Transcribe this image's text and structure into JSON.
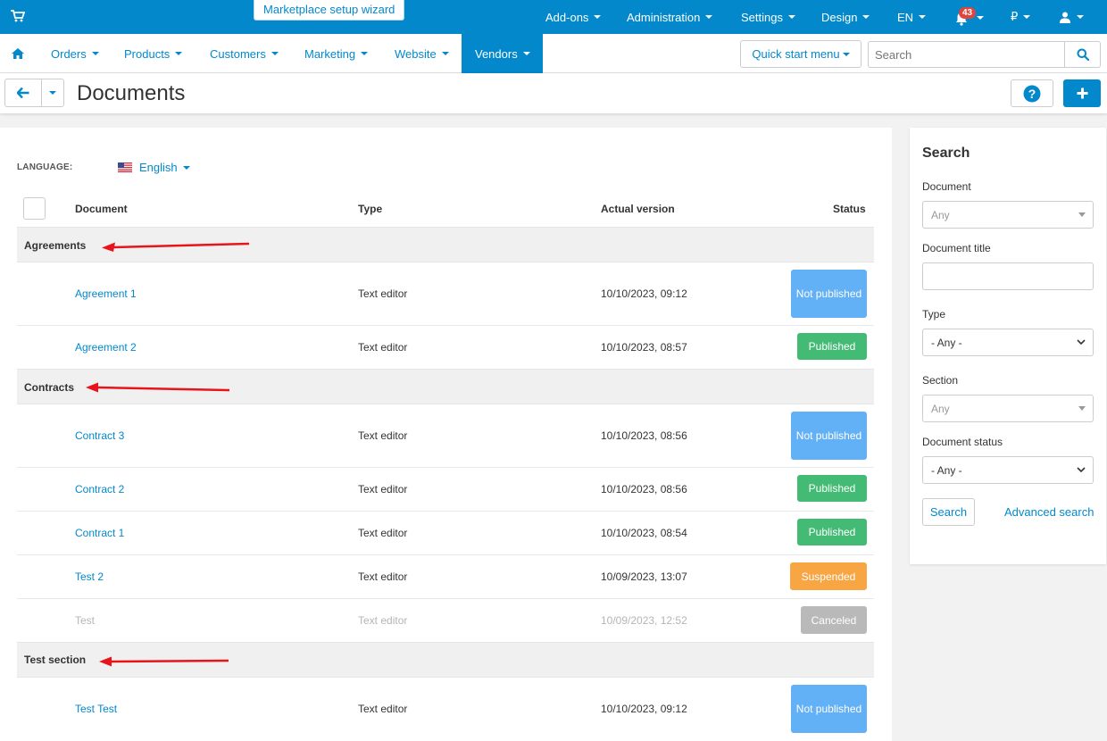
{
  "topbar": {
    "wizard_label": "Marketplace setup wizard",
    "menu": [
      {
        "label": "Add-ons"
      },
      {
        "label": "Administration"
      },
      {
        "label": "Settings"
      },
      {
        "label": "Design"
      },
      {
        "label": "EN"
      }
    ],
    "notifications_count": "43",
    "currency": "₽"
  },
  "nav": {
    "items": [
      {
        "label": "Orders"
      },
      {
        "label": "Products"
      },
      {
        "label": "Customers"
      },
      {
        "label": "Marketing"
      },
      {
        "label": "Website"
      },
      {
        "label": "Vendors"
      }
    ],
    "quick_start": "Quick start menu",
    "search_placeholder": "Search"
  },
  "page": {
    "title": "Documents"
  },
  "main": {
    "language_label": "LANGUAGE:",
    "language_value": "English",
    "columns": {
      "document": "Document",
      "type": "Type",
      "version": "Actual version",
      "status": "Status"
    },
    "groups": [
      {
        "name": "Agreements",
        "rows": [
          {
            "doc": "Agreement 1",
            "type": "Text editor",
            "version": "10/10/2023, 09:12",
            "status": "Not published"
          },
          {
            "doc": "Agreement 2",
            "type": "Text editor",
            "version": "10/10/2023, 08:57",
            "status": "Published"
          }
        ]
      },
      {
        "name": "Contracts",
        "rows": [
          {
            "doc": "Contract 3",
            "type": "Text editor",
            "version": "10/10/2023, 08:56",
            "status": "Not published"
          },
          {
            "doc": "Contract 2",
            "type": "Text editor",
            "version": "10/10/2023, 08:56",
            "status": "Published"
          },
          {
            "doc": "Contract 1",
            "type": "Text editor",
            "version": "10/10/2023, 08:54",
            "status": "Published"
          },
          {
            "doc": "Test 2",
            "type": "Text editor",
            "version": "10/09/2023, 13:07",
            "status": "Suspended"
          },
          {
            "doc": "Test",
            "type": "Text editor",
            "version": "10/09/2023, 12:52",
            "status": "Canceled"
          }
        ]
      },
      {
        "name": "Test section",
        "rows": [
          {
            "doc": "Test Test",
            "type": "Text editor",
            "version": "10/10/2023, 09:12",
            "status": "Not published"
          }
        ]
      }
    ]
  },
  "sidebar": {
    "title": "Search",
    "document_label": "Document",
    "document_value": "Any",
    "doc_title_label": "Document title",
    "type_label": "Type",
    "type_value": "- Any -",
    "section_label": "Section",
    "section_value": "Any",
    "status_label": "Document status",
    "status_value": "- Any -",
    "search_button": "Search",
    "advanced_link": "Advanced search"
  },
  "colors": {
    "accent": "#0388cc",
    "not_published": "#62b0f5",
    "published": "#44bb74",
    "suspended": "#f8a544",
    "canceled": "#b9b9b9",
    "annotation_arrow": "#e8141b"
  }
}
